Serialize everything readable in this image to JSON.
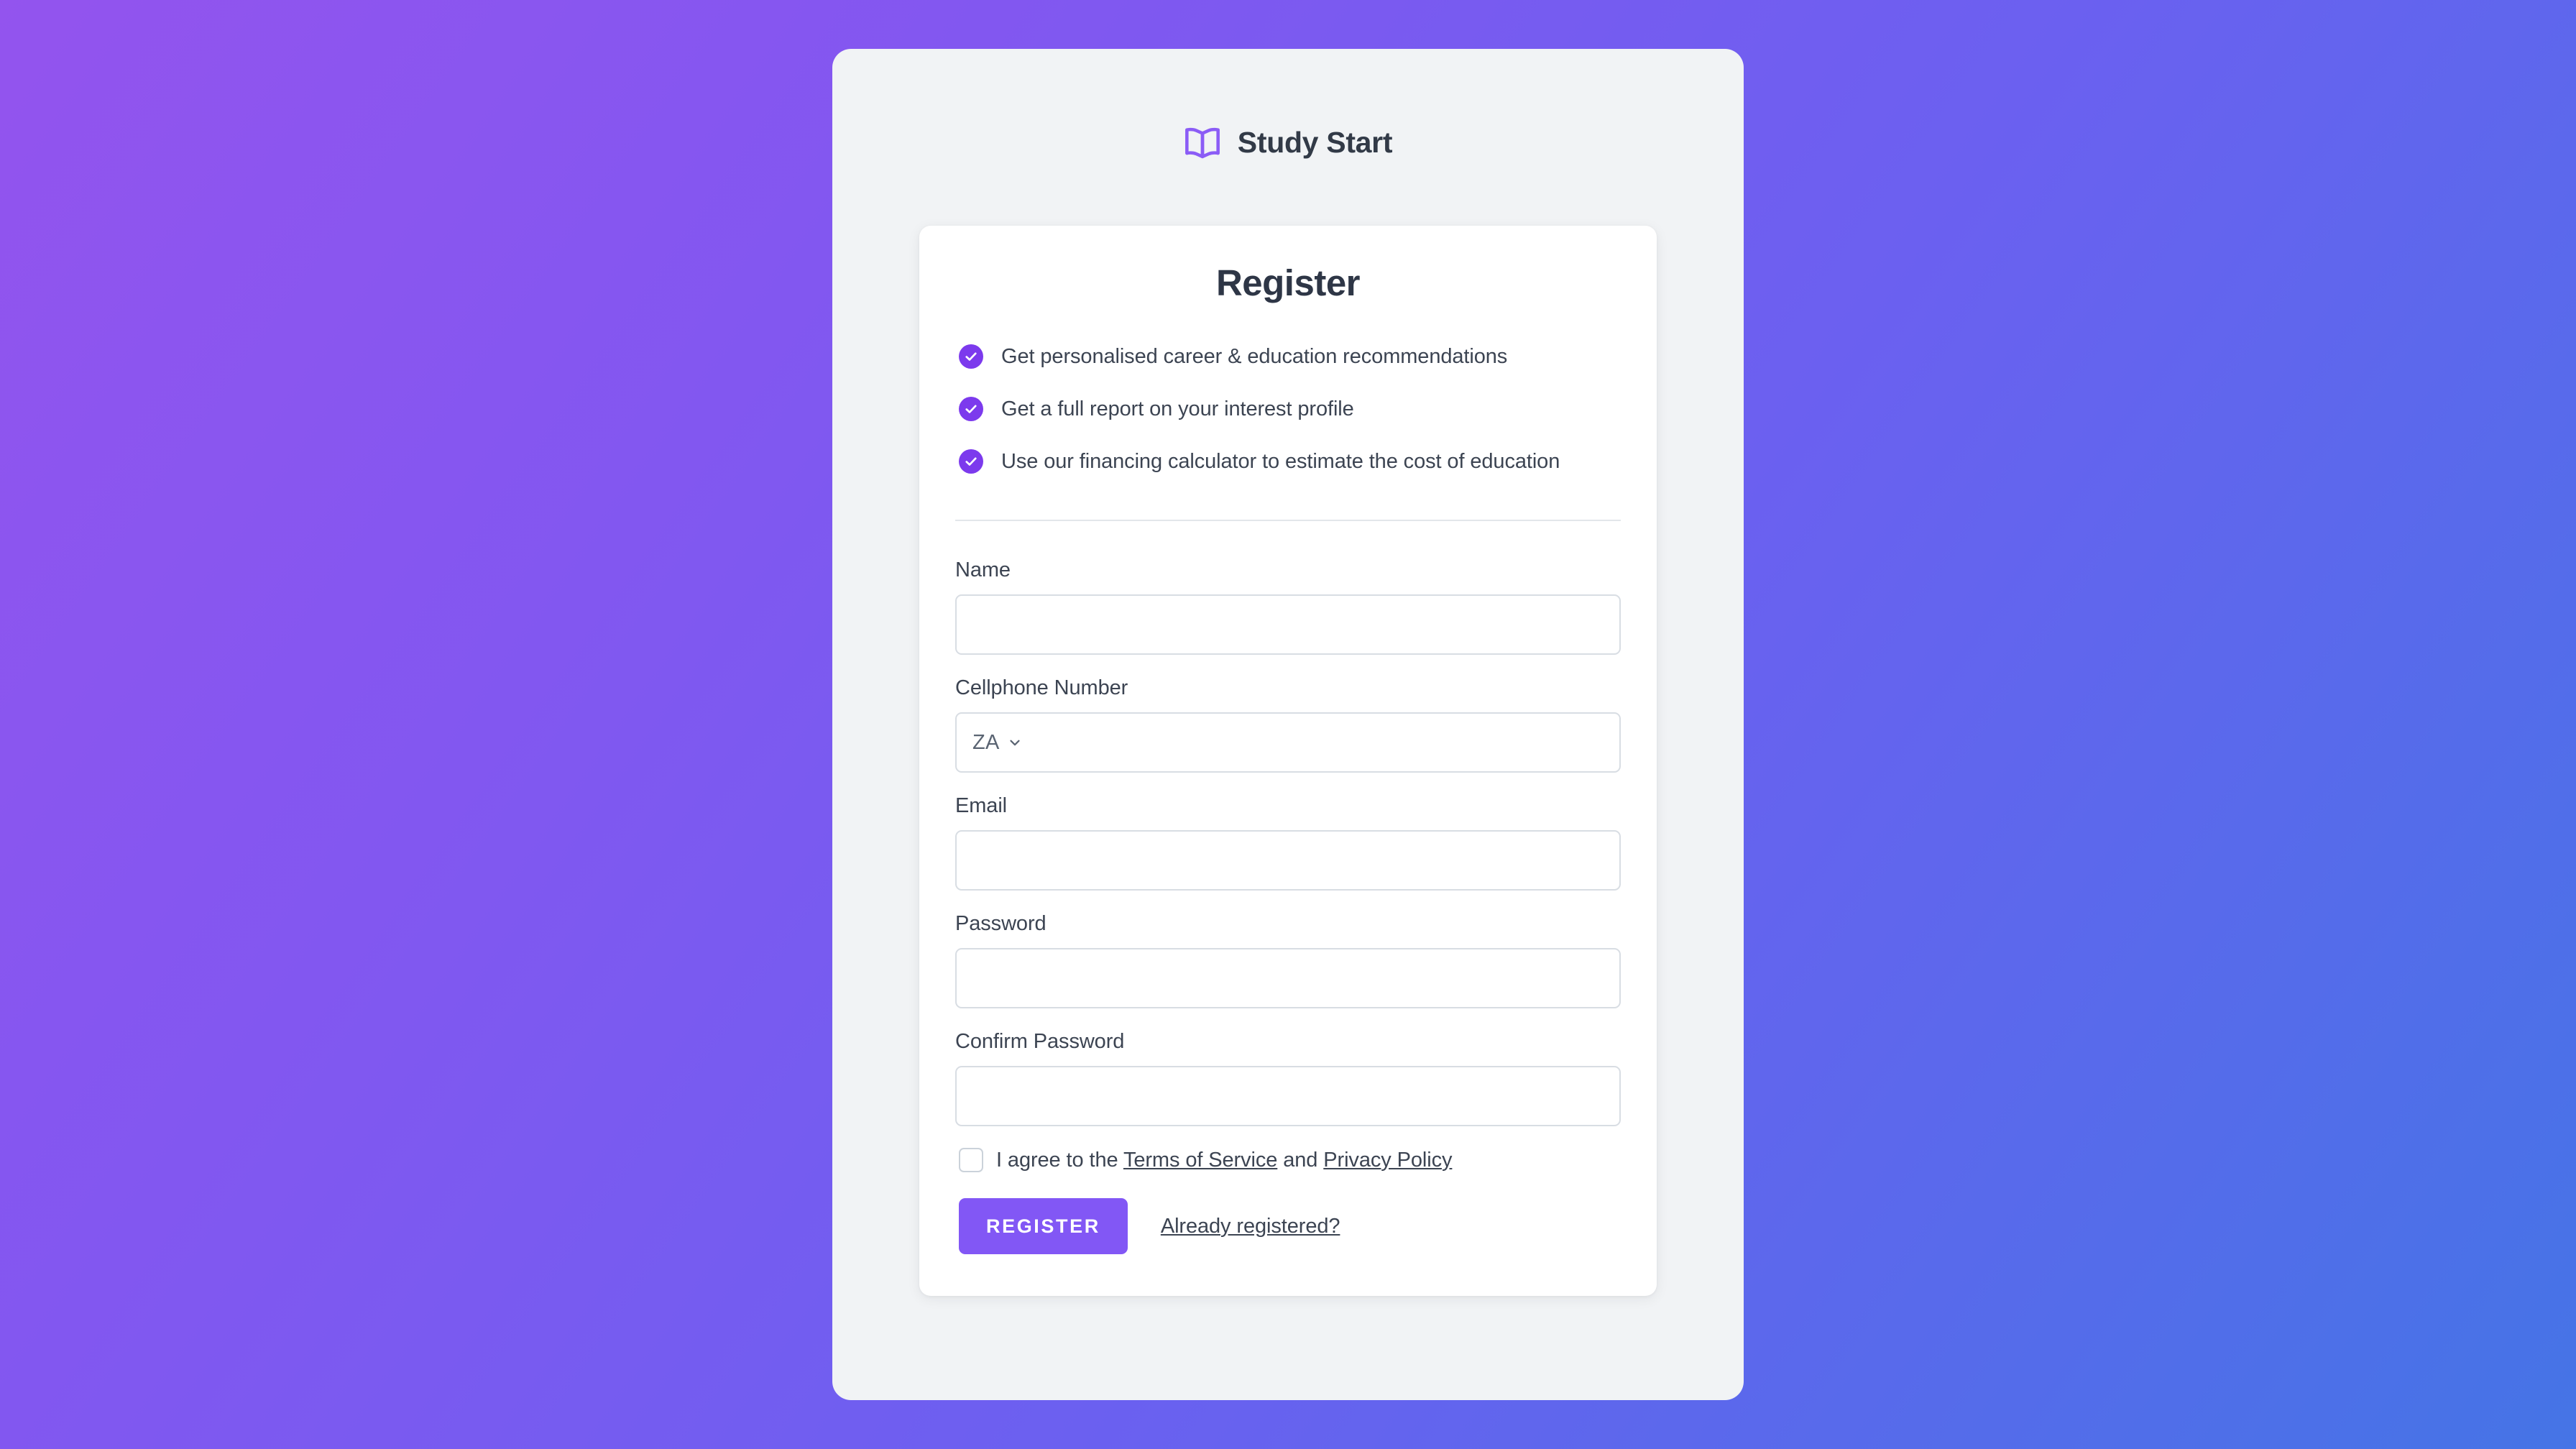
{
  "brand": {
    "name": "Study Start",
    "logo_icon": "open-book-icon",
    "logo_color": "#8B5CF6"
  },
  "card": {
    "title": "Register",
    "benefits": [
      {
        "icon": "check-circle-icon",
        "text": "Get personalised career & education recommendations"
      },
      {
        "icon": "check-circle-icon",
        "text": "Get a full report on your interest profile"
      },
      {
        "icon": "check-circle-icon",
        "text": "Use our financing calculator to estimate the cost of education"
      }
    ],
    "form": {
      "name": {
        "label": "Name",
        "value": "",
        "placeholder": ""
      },
      "cellphone": {
        "label": "Cellphone Number",
        "country_code": "ZA",
        "chevron_icon": "chevron-down-icon",
        "value": "",
        "placeholder": ""
      },
      "email": {
        "label": "Email",
        "value": "",
        "placeholder": ""
      },
      "password": {
        "label": "Password",
        "value": "",
        "placeholder": ""
      },
      "confirm_password": {
        "label": "Confirm Password",
        "value": "",
        "placeholder": ""
      }
    },
    "terms": {
      "checked": false,
      "prefix": "I agree to the ",
      "terms_link": "Terms of Service",
      "conjunction": " and ",
      "privacy_link": "Privacy Policy"
    },
    "actions": {
      "register_label": "REGISTER",
      "already_registered_label": "Already registered?"
    }
  },
  "colors": {
    "accent_purple": "#7C3AED",
    "button_purple": "#8257F5",
    "gradient_start": "#9354EE",
    "gradient_end": "#4574E6",
    "panel_bg": "#F1F3F5",
    "card_bg": "#FFFFFF",
    "text_dark": "#3C4452",
    "border_gray": "#D8DDE3"
  }
}
